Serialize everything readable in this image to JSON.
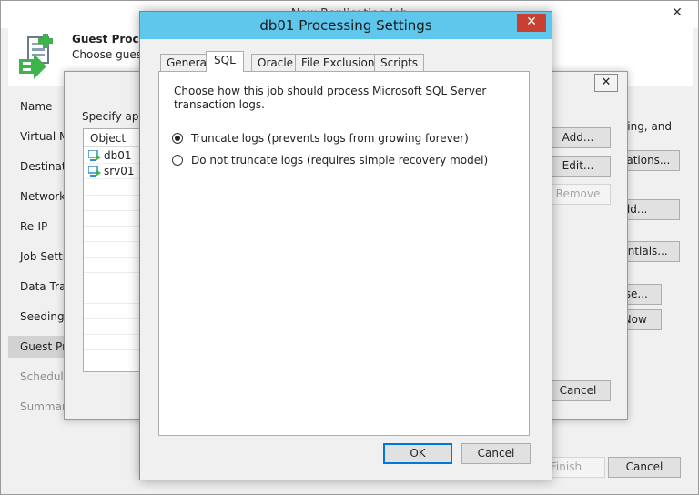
{
  "wizard": {
    "title": "New Replication Job",
    "close_glyph": "✕",
    "header_title": "Guest Processing",
    "header_subtitle": "Choose guest OS processing options available for running VMs.",
    "nav_items": [
      {
        "label": "Name"
      },
      {
        "label": "Virtual Machines"
      },
      {
        "label": "Destination"
      },
      {
        "label": "Network"
      },
      {
        "label": "Re-IP"
      },
      {
        "label": "Job Settings"
      },
      {
        "label": "Data Transfer"
      },
      {
        "label": "Seeding"
      },
      {
        "label": "Guest Processing"
      },
      {
        "label": "Schedule"
      },
      {
        "label": "Summary"
      }
    ],
    "right_text": "sing, and",
    "buttons": {
      "applications": "Applications...",
      "add": "Add...",
      "credentials": "Credentials...",
      "choose": "Choose...",
      "test_now": "Test Now",
      "finish": "Finish",
      "cancel": "Cancel"
    }
  },
  "mid_dialog": {
    "close_glyph": "✕",
    "label": "Specify application-aware processing settings for individual objects:",
    "list_header": "Object",
    "objects": [
      {
        "name": "db01"
      },
      {
        "name": "srv01"
      }
    ],
    "buttons": {
      "add": "Add...",
      "edit": "Edit...",
      "remove": "Remove",
      "cancel": "Cancel"
    }
  },
  "front_dialog": {
    "title": "db01 Processing Settings",
    "close_glyph": "✕",
    "tabs": [
      {
        "label": "General"
      },
      {
        "label": "SQL"
      },
      {
        "label": "Oracle"
      },
      {
        "label": "File Exclusions"
      },
      {
        "label": "Scripts"
      }
    ],
    "selected_tab": "SQL",
    "sql": {
      "description": "Choose how this job should process Microsoft SQL Server transaction logs.",
      "options": [
        {
          "label": "Truncate logs (prevents logs from growing forever)",
          "checked": true
        },
        {
          "label": "Do not truncate logs (requires simple recovery model)",
          "checked": false
        }
      ]
    },
    "buttons": {
      "ok": "OK",
      "cancel": "Cancel"
    }
  },
  "colors": {
    "title_accent": "#5fc6ec",
    "close_red": "#c84031",
    "logo_green": "#3cb44b"
  }
}
